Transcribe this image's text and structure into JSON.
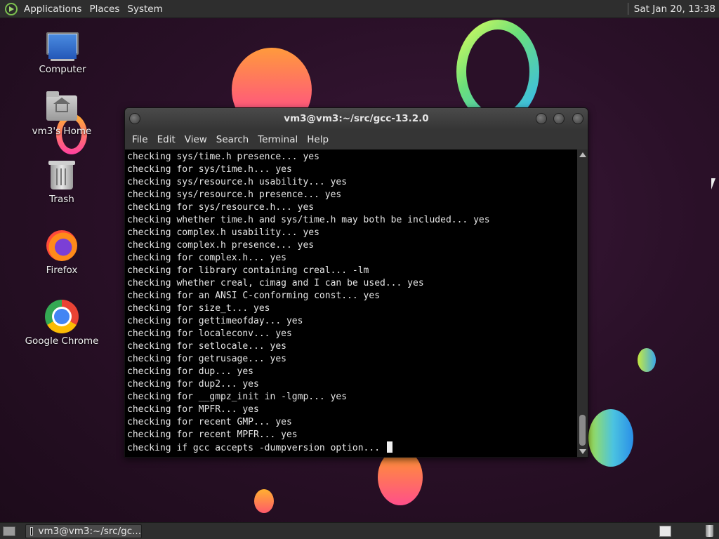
{
  "top_panel": {
    "menus": [
      "Applications",
      "Places",
      "System"
    ],
    "clock": "Sat Jan 20, 13:38"
  },
  "desktop": {
    "icons": [
      {
        "label": "Computer",
        "icon": "computer-icon"
      },
      {
        "label": "vm3's Home",
        "icon": "home-folder-icon"
      },
      {
        "label": "Trash",
        "icon": "trash-icon"
      },
      {
        "label": "Firefox",
        "icon": "firefox-icon"
      },
      {
        "label": "Google Chrome",
        "icon": "chrome-icon"
      }
    ]
  },
  "terminal": {
    "title": "vm3@vm3:~/src/gcc-13.2.0",
    "menus": [
      "File",
      "Edit",
      "View",
      "Search",
      "Terminal",
      "Help"
    ],
    "lines": [
      "checking sys/time.h presence... yes",
      "checking for sys/time.h... yes",
      "checking sys/resource.h usability... yes",
      "checking sys/resource.h presence... yes",
      "checking for sys/resource.h... yes",
      "checking whether time.h and sys/time.h may both be included... yes",
      "checking complex.h usability... yes",
      "checking complex.h presence... yes",
      "checking for complex.h... yes",
      "checking for library containing creal... -lm",
      "checking whether creal, cimag and I can be used... yes",
      "checking for an ANSI C-conforming const... yes",
      "checking for size_t... yes",
      "checking for gettimeofday... yes",
      "checking for localeconv... yes",
      "checking for setlocale... yes",
      "checking for getrusage... yes",
      "checking for dup... yes",
      "checking for dup2... yes",
      "checking for __gmpz_init in -lgmp... yes",
      "checking for MPFR... yes",
      "checking for recent GMP... yes",
      "checking for recent MPFR... yes",
      "checking if gcc accepts -dumpversion option... "
    ]
  },
  "bottom_panel": {
    "task_label": "vm3@vm3:~/src/gc..."
  }
}
